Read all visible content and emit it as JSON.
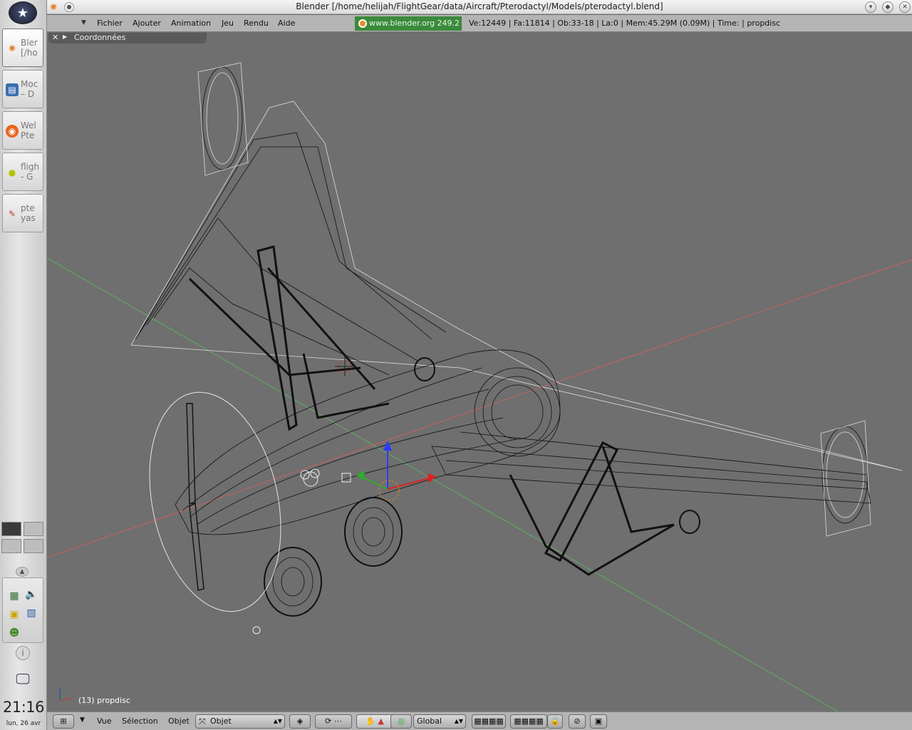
{
  "window": {
    "title": "Blender [/home/helijah/FlightGear/data/Aircraft/Pterodactyl/Models/pterodactyl.blend]"
  },
  "taskbar": {
    "tasks": [
      {
        "label": "Bler\n[/ho",
        "icon": "blender-icon"
      },
      {
        "label": "Moc\n– D",
        "icon": "document-icon"
      },
      {
        "label": "Wel\nPte",
        "icon": "firefox-icon"
      },
      {
        "label": "fligh\n- G",
        "icon": "bulb-icon"
      },
      {
        "label": "pte\nyas",
        "icon": "text-editor-icon"
      }
    ],
    "clock": "21:16",
    "date": "lun, 26 avr"
  },
  "header": {
    "menus": [
      "Fichier",
      "Ajouter",
      "Animation",
      "Jeu",
      "Rendu",
      "Aide"
    ],
    "url_badge": "www.blender.org 249.2",
    "stats": "Ve:12449 | Fa:11814 | Ob:33-18 | La:0  | Mem:45.29M (0.09M)  | Time: | propdisc"
  },
  "viewport": {
    "panel_label": "Coordonnées",
    "object_info": "(13) propdisc"
  },
  "toolbar": {
    "menus": [
      "Vue",
      "Sélection",
      "Objet"
    ],
    "mode": "Objet",
    "orientation": "Global"
  },
  "colors": {
    "viewport_bg": "#6f6f6f",
    "header_bg": "#b4b4b4",
    "url_badge_bg": "#3b8a3b",
    "x_axis": "#c05050",
    "y_axis": "#4caf50"
  }
}
